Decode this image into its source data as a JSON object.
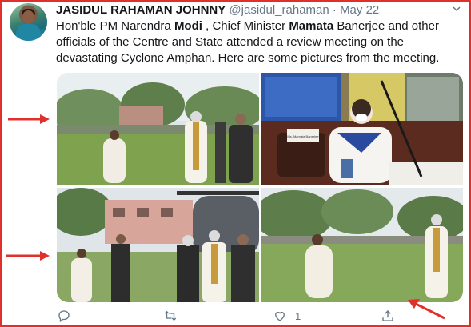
{
  "tweet": {
    "author_name": "JASIDUL RAHAMAN JOHNNY",
    "handle": "@jasidul_rahaman",
    "separator": "·",
    "date": "May 22",
    "text_parts": [
      {
        "t": "Hon'ble PM Narendra ",
        "bold": false
      },
      {
        "t": "Modi",
        "bold": true
      },
      {
        "t": " , Chief Minister ",
        "bold": false
      },
      {
        "t": "Mamata",
        "bold": true
      },
      {
        "t": " Banerjee and other officials of the Centre and State attended a review meeting on the devastating Cyclone Amphan. Here are some pictures from the meeting.",
        "bold": false
      }
    ],
    "nameplate_text": "Ms. Mamata Banerjee"
  },
  "actions": {
    "reply_icon": "reply-icon",
    "retweet_icon": "retweet-icon",
    "like_icon": "heart-icon",
    "like_count": "1",
    "share_icon": "share-icon"
  },
  "colors": {
    "frame": "#e0302c",
    "arrow": "#e0302c",
    "text": "#14171a",
    "muted": "#657786"
  }
}
